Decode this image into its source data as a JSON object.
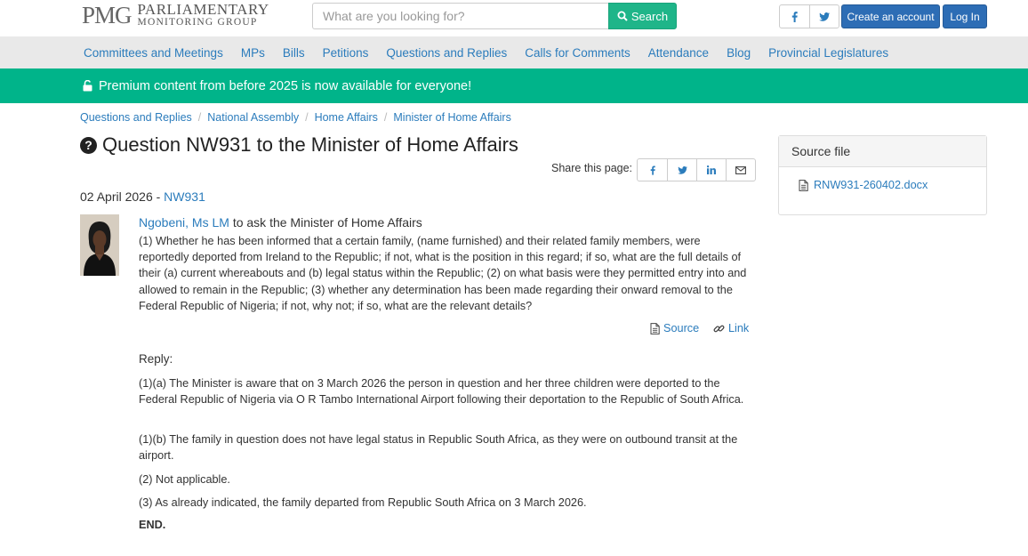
{
  "header": {
    "logo_mark": "PMG",
    "logo_line1": "PARLIAMENTARY",
    "logo_line2": "MONITORING GROUP",
    "search_placeholder": "What are you looking for?",
    "search_button": "Search",
    "create_account": "Create an account",
    "login": "Log In",
    "social": [
      {
        "icon": "facebook-icon"
      },
      {
        "icon": "twitter-icon"
      }
    ]
  },
  "nav": {
    "items": [
      "Committees and Meetings",
      "MPs",
      "Bills",
      "Petitions",
      "Questions and Replies",
      "Calls for Comments",
      "Attendance",
      "Blog",
      "Provincial Legislatures"
    ]
  },
  "banner": {
    "icon": "unlock-icon",
    "text": "Premium content from before 2025 is now available for everyone!"
  },
  "breadcrumb": [
    "Questions and Replies",
    "National Assembly",
    "Home Affairs",
    "Minister of Home Affairs"
  ],
  "page": {
    "title": "Question NW931 to the Minister of Home Affairs",
    "share_label": "Share this page:",
    "date": "02 April 2026 - ",
    "question_code": "NW931"
  },
  "question": {
    "member_name": "Ngobeni, Ms LM",
    "asks": " to ask the Minister of Home Affairs",
    "text": "(1) Whether he has been informed that a certain family, (name furnished) and their related family members, were reportedly deported from Ireland to the Republic; if not, what is the position in this regard; if so, what are the full details of their (a) current whereabouts and (b) legal status within the Republic; (2) on what basis were they permitted entry into and allowed to remain in the Republic; (3) whether any determination has been made regarding their onward removal to the Federal Republic of Nigeria; if not, why not; if so, what are the relevant details?",
    "source_label": "Source",
    "link_label": "Link"
  },
  "reply": {
    "heading": "Reply:",
    "paragraphs": [
      "(1)(a) The Minister is aware that on 3 March 2026 the person in question and her three children were deported to the Federal Republic of Nigeria via O R Tambo International Airport following their deportation to the Republic of South Africa.",
      "(1)(b) The family in question does not have legal status in Republic South Africa, as they were on outbound transit at the airport.",
      "(2) Not applicable.",
      "(3) As already indicated, the family departed from Republic South Africa on 3 March 2026."
    ],
    "end": "END."
  },
  "sidebar": {
    "heading": "Source file",
    "file_name": "RNW931-260402.docx"
  },
  "colors": {
    "link": "#2b7cbc",
    "banner": "#00b48a",
    "search_button": "#1fb589",
    "primary_button": "#2d6db5",
    "nav_bg": "#e9e9e9"
  }
}
